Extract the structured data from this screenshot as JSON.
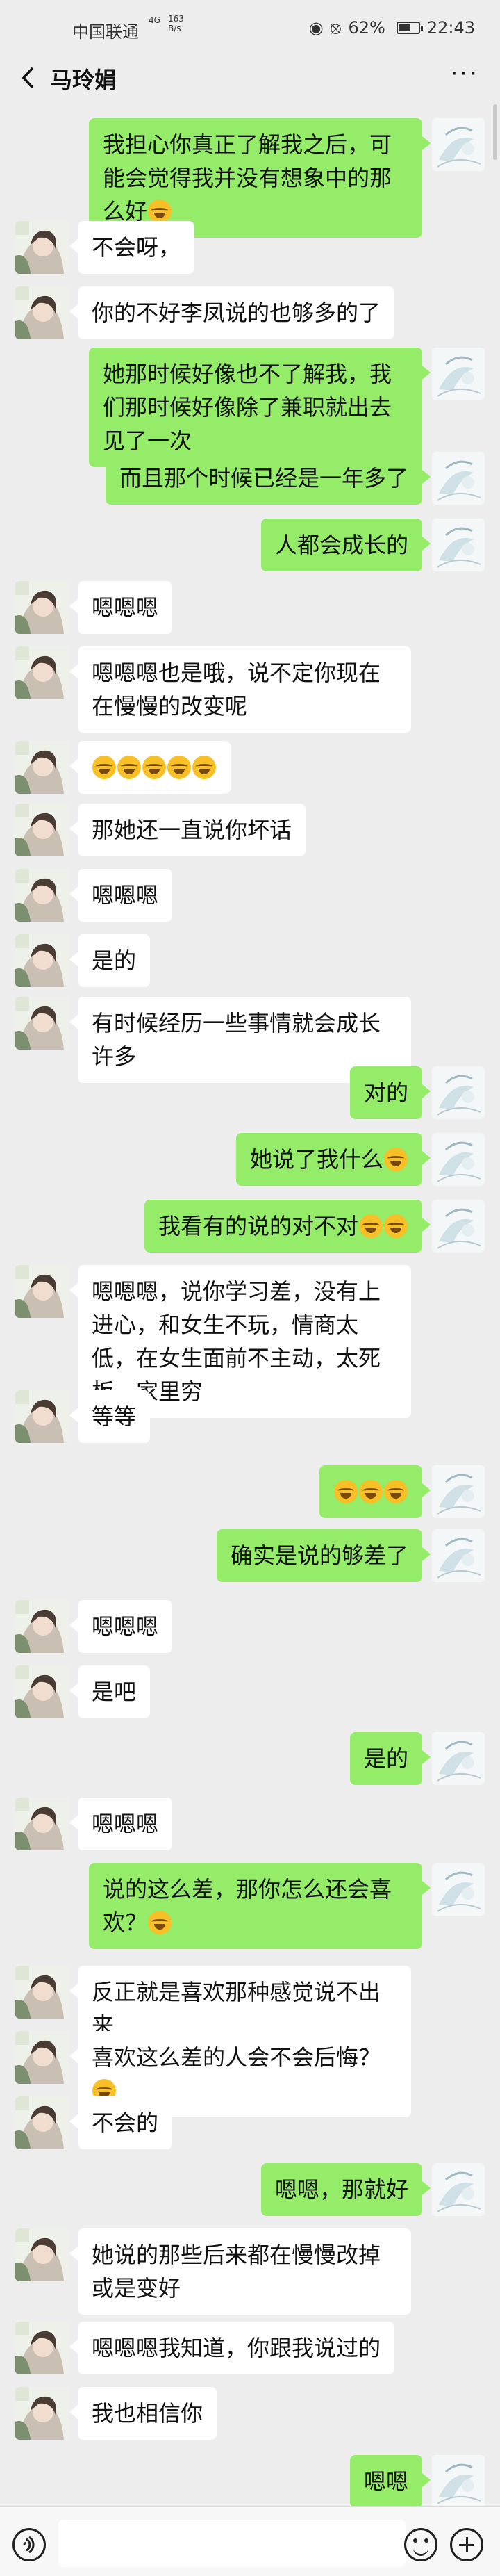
{
  "status_bar": {
    "carrier": "中国联通",
    "network": "4G",
    "speed_value": "163",
    "speed_unit": "B/s",
    "battery_percent": "62%",
    "battery_level": 0.62,
    "time": "22:43"
  },
  "header": {
    "contact_name": "马玲娟",
    "more_label": "···"
  },
  "messages": [
    {
      "side": "right",
      "text": "我担心你真正了解我之后，可能会觉得我并没有想象中的那么好",
      "emoji_after": 1
    },
    {
      "side": "left",
      "text": "不会呀，"
    },
    {
      "side": "left",
      "text": "你的不好李凤说的也够多的了"
    },
    {
      "side": "right",
      "text": "她那时候好像也不了解我，我们那时候好像除了兼职就出去见了一次"
    },
    {
      "side": "right",
      "text": "而且那个时候已经是一年多了"
    },
    {
      "side": "right",
      "text": "人都会成长的"
    },
    {
      "side": "left",
      "text": "嗯嗯嗯"
    },
    {
      "side": "left",
      "text": "嗯嗯嗯也是哦，说不定你现在在慢慢的改变呢"
    },
    {
      "side": "left",
      "text": "",
      "emoji_after": 5
    },
    {
      "side": "left",
      "text": "那她还一直说你坏话"
    },
    {
      "side": "left",
      "text": "嗯嗯嗯"
    },
    {
      "side": "left",
      "text": "是的"
    },
    {
      "side": "left",
      "text": "有时候经历一些事情就会成长许多"
    },
    {
      "side": "right",
      "text": "对的"
    },
    {
      "side": "right",
      "text": "她说了我什么",
      "emoji_after": 1
    },
    {
      "side": "right",
      "text": "我看有的说的对不对",
      "emoji_after": 2
    },
    {
      "side": "left",
      "text": "嗯嗯嗯，说你学习差，没有上进心，和女生不玩，情商太低，在女生面前不主动，太死板，家里穷"
    },
    {
      "side": "left",
      "text": "等等"
    },
    {
      "side": "right",
      "text": "",
      "emoji_after": 3
    },
    {
      "side": "right",
      "text": "确实是说的够差了"
    },
    {
      "side": "left",
      "text": "嗯嗯嗯"
    },
    {
      "side": "left",
      "text": "是吧"
    },
    {
      "side": "right",
      "text": "是的"
    },
    {
      "side": "left",
      "text": "嗯嗯嗯"
    },
    {
      "side": "right",
      "text": "说的这么差，那你怎么还会喜欢？",
      "emoji_after": 1
    },
    {
      "side": "left",
      "text": "反正就是喜欢那种感觉说不出来"
    },
    {
      "side": "left",
      "text": "喜欢这么差的人会不会后悔？",
      "emoji_after": 1
    },
    {
      "side": "left",
      "text": "不会的"
    },
    {
      "side": "right",
      "text": "嗯嗯，那就好"
    },
    {
      "side": "left",
      "text": "她说的那些后来都在慢慢改掉或是变好"
    },
    {
      "side": "left",
      "text": "嗯嗯嗯我知道，你跟我说过的"
    },
    {
      "side": "left",
      "text": "我也相信你"
    },
    {
      "side": "right",
      "text": "嗯嗯"
    }
  ],
  "input_bar": {
    "voice_icon": "voice-icon",
    "emoji_icon": "emoji-icon",
    "plus_icon": "plus-icon"
  }
}
